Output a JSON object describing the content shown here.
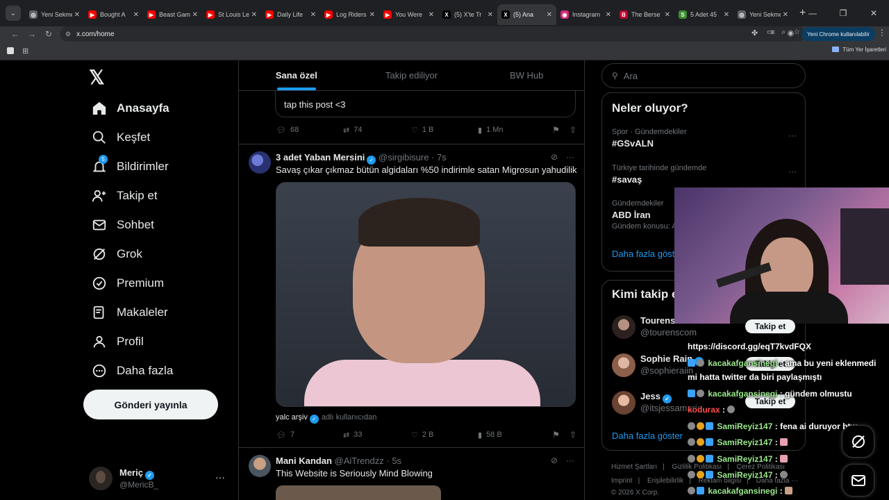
{
  "browser": {
    "tabs": [
      {
        "title": "Yeni Sekme",
        "color": "#5f6368",
        "glyph": "◎"
      },
      {
        "title": "Bought A",
        "color": "#ff0000",
        "glyph": "▶"
      },
      {
        "title": "Beast Gam",
        "color": "#ff0000",
        "glyph": "▶"
      },
      {
        "title": "St Louis Le",
        "color": "#ff0000",
        "glyph": "▶"
      },
      {
        "title": "Daily Life",
        "color": "#ff0000",
        "glyph": "▶"
      },
      {
        "title": "Log Riders",
        "color": "#ff0000",
        "glyph": "▶"
      },
      {
        "title": "You Were",
        "color": "#ff0000",
        "glyph": "▶"
      },
      {
        "title": "(5) X'te Tr",
        "color": "#000000",
        "glyph": "X"
      },
      {
        "title": "(5) Ana",
        "color": "#000000",
        "glyph": "X"
      },
      {
        "title": "Instagram",
        "color": "#d62976",
        "glyph": "◉"
      },
      {
        "title": "The Berse",
        "color": "#c3002f",
        "glyph": "B"
      },
      {
        "title": "5 Adet 45",
        "color": "#3c8d2f",
        "glyph": "S"
      },
      {
        "title": "Yeni Sekme",
        "color": "#5f6368",
        "glyph": "◎"
      }
    ],
    "url": "x.com/home",
    "profile_label": "Yeni Chrome kullanılabilir",
    "all_bookmarks": "Tüm Yer İşaretleri"
  },
  "nav": {
    "items": [
      {
        "label": "Anasayfa",
        "icon": "home-icon",
        "name": "home"
      },
      {
        "label": "Keşfet",
        "icon": "search-icon",
        "name": "explore"
      },
      {
        "label": "Bildirimler",
        "icon": "bell-icon",
        "name": "notifications"
      },
      {
        "label": "Takip et",
        "icon": "person-add-icon",
        "name": "follow"
      },
      {
        "label": "Sohbet",
        "icon": "mail-icon",
        "name": "chat"
      },
      {
        "label": "Grok",
        "icon": "grok-icon",
        "name": "grok"
      },
      {
        "label": "Premium",
        "icon": "premium-icon",
        "name": "premium"
      },
      {
        "label": "Makaleler",
        "icon": "articles-icon",
        "name": "articles"
      },
      {
        "label": "Profil",
        "icon": "profile-icon",
        "name": "profile"
      },
      {
        "label": "Daha fazla",
        "icon": "more-icon",
        "name": "more"
      }
    ],
    "notif_badge": "5",
    "post_button": "Gönderi yayınla",
    "account": {
      "name": "Meriç",
      "handle": "@MericB_"
    }
  },
  "main": {
    "tabs": [
      "Sana özel",
      "Takip ediliyor",
      "BW Hub"
    ],
    "quote_text": "tap this post <3",
    "tweet0_stats": {
      "replies": "68",
      "retweets": "74",
      "likes": "1 B",
      "views": "1 Mn"
    },
    "tweet1": {
      "name": "3 adet Yaban Mersini",
      "handle": "@sirgibisure · 7s",
      "text": "Savaş çıkar çıkmaz bütün algidaları %50 indirimle satan Migrosun yahudilik",
      "media_source": "yalc arşiv",
      "media_sub": "adlı kullanıcıdan",
      "stats": {
        "replies": "7",
        "retweets": "33",
        "likes": "2 B",
        "views": "58 B"
      }
    },
    "tweet2": {
      "name": "Mani Kandan",
      "handle": "@AiTrendzz · 5s",
      "text": "This Website is Seriously Mind Blowing"
    }
  },
  "right": {
    "search_placeholder": "Ara",
    "trends_title": "Neler oluyor?",
    "trends": [
      {
        "meta": "Spor · Gündemdekiler",
        "name": "#GSvALN"
      },
      {
        "meta": "Türkiye tarihinde gündemde",
        "name": "#savaş"
      },
      {
        "meta": "Gündemdekiler",
        "name": "ABD İran",
        "extra": "Gündem konusu: A"
      }
    ],
    "show_more": "Daha fazla göster",
    "who_title": "Kimi takip e",
    "who": [
      {
        "name": "Tourens",
        "handle": "@tourenscom"
      },
      {
        "name": "Sophie Rain",
        "handle": "@sophieraiin"
      },
      {
        "name": "Jess",
        "handle": "@itsjessamarie"
      }
    ],
    "who_show_more": "Daha fazla göster",
    "footer_line1": [
      "Hizmet Şartları",
      "Gizlilik Politikası",
      "Çerez Politikası"
    ],
    "footer_line2": [
      "Imprint",
      "Erişilebilirlik",
      "Reklam bilgisi",
      "Daha fazla ···"
    ],
    "copyright": "© 2026 X Corp."
  },
  "stream": {
    "follow_label": "Takip et",
    "chat": [
      {
        "user": "",
        "text": "https://discord.gg/eqT7kvdFQX"
      },
      {
        "user": "kacakafgansinegi",
        "text": ": ama bu yeni eklenmedi"
      },
      {
        "user": "",
        "text": "mi hatta twitter da biri paylaşmıştı"
      },
      {
        "user": "kacakafgansinegi",
        "text": ": gündem olmustu"
      },
      {
        "user": "kodurax",
        "text": ":"
      },
      {
        "user": "SamiReyiz147",
        "text": ": fena ai duruyor btw"
      },
      {
        "user": "SamiReyiz147",
        "text": ":"
      },
      {
        "user": "SamiReyiz147",
        "text": ":"
      },
      {
        "user": "SamiReyiz147",
        "text": ":"
      },
      {
        "user": "kacakafgansinegi",
        "text": ":"
      }
    ]
  }
}
